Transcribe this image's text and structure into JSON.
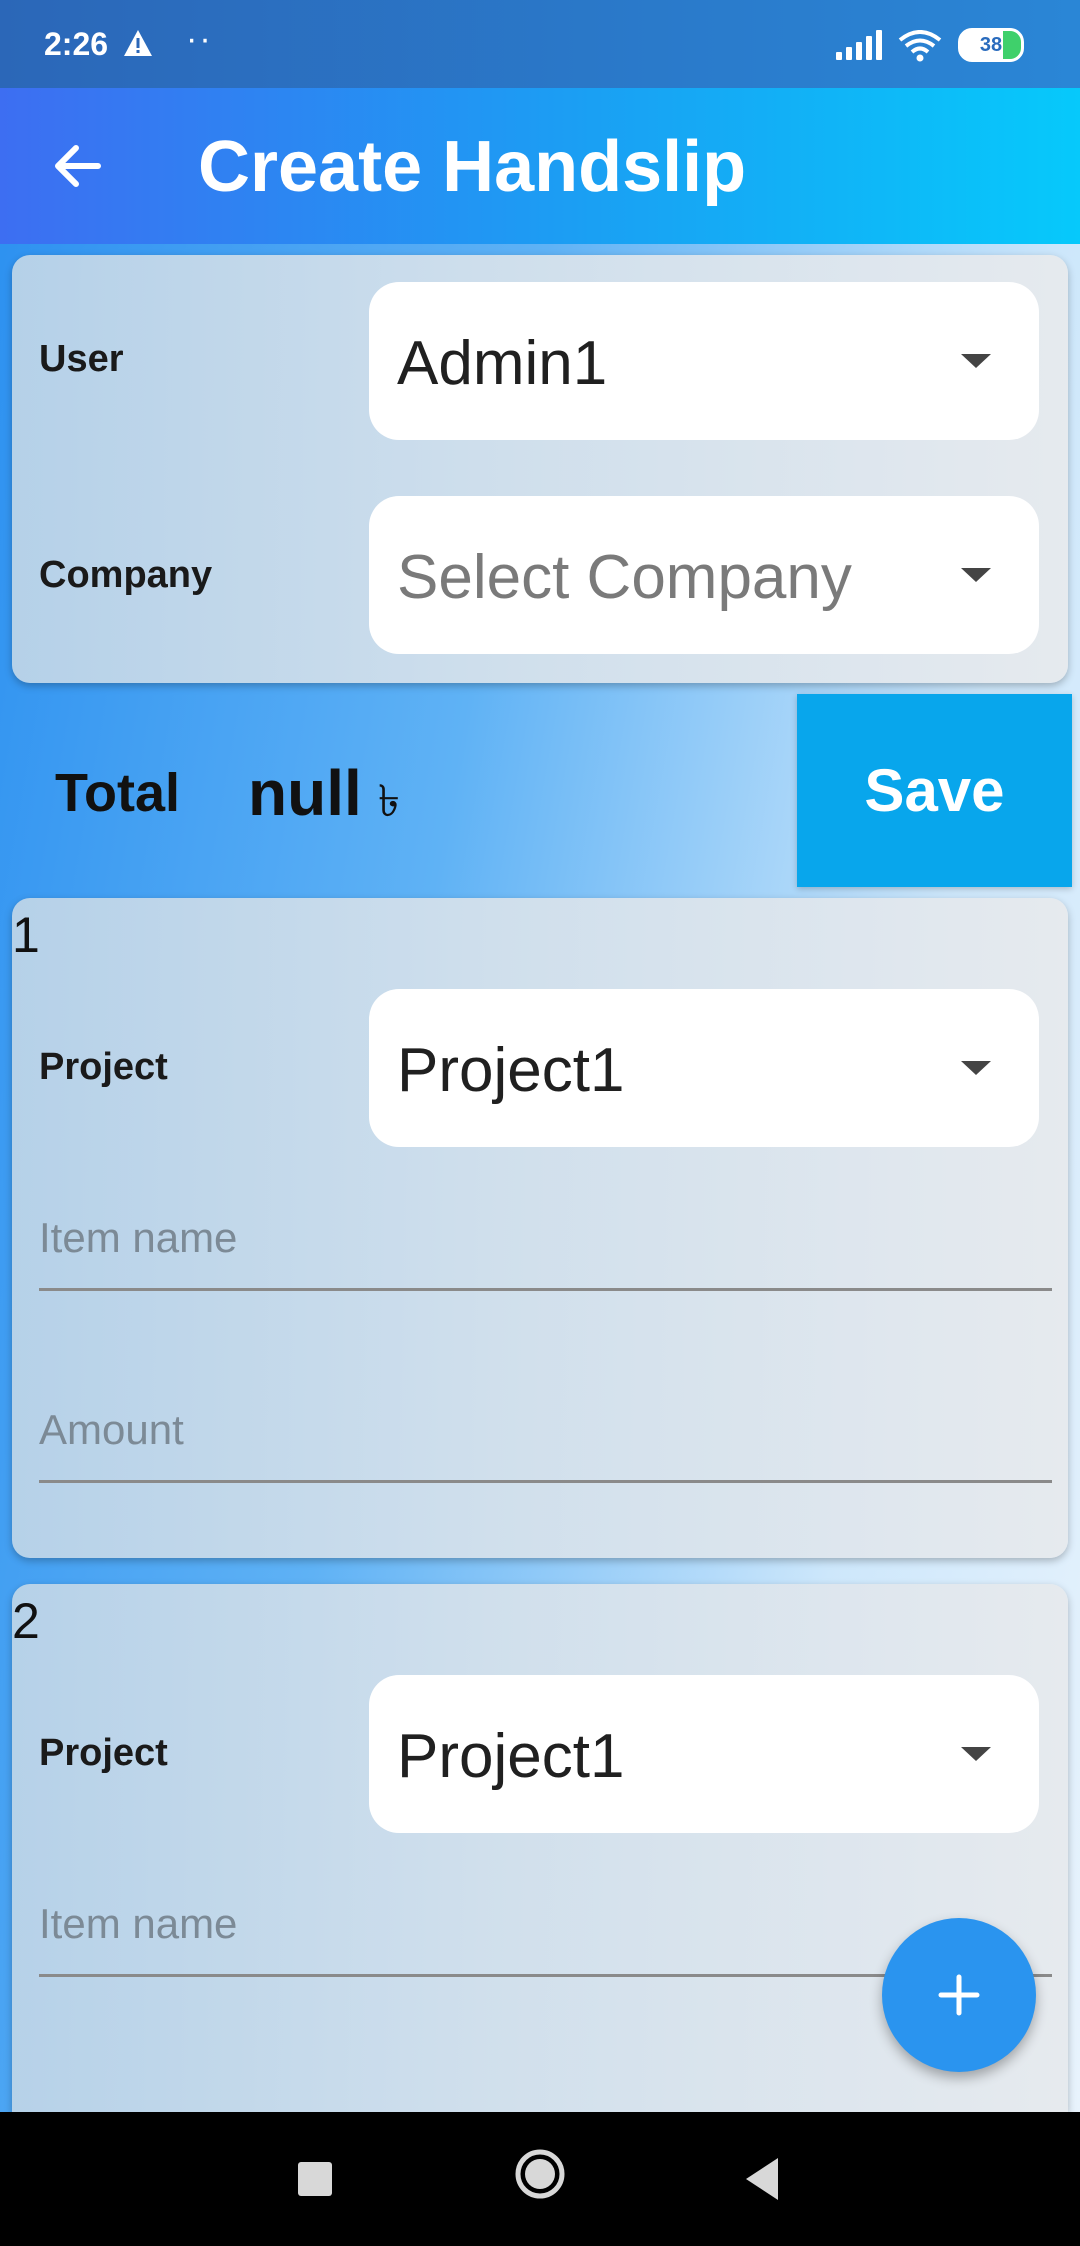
{
  "status_bar": {
    "time": "2:26",
    "battery": "38"
  },
  "app_bar": {
    "title": "Create Handslip"
  },
  "header_card": {
    "user_label": "User",
    "user_value": "Admin1",
    "company_label": "Company",
    "company_placeholder": "Select Company"
  },
  "total": {
    "label": "Total",
    "value": "null",
    "currency_symbol": "৳"
  },
  "save_label": "Save",
  "items": [
    {
      "index": "1",
      "project_label": "Project",
      "project_value": "Project1",
      "item_name_placeholder": "Item name",
      "amount_placeholder": "Amount"
    },
    {
      "index": "2",
      "project_label": "Project",
      "project_value": "Project1",
      "item_name_placeholder": "Item name"
    }
  ],
  "colors": {
    "accent": "#08a6ec",
    "fab": "#2a94ef",
    "appbar_start": "#3d6ef2",
    "appbar_end": "#06c9fb"
  },
  "icons": {
    "back": "arrow-left-icon",
    "add": "plus-icon",
    "warning": "warning-icon"
  }
}
